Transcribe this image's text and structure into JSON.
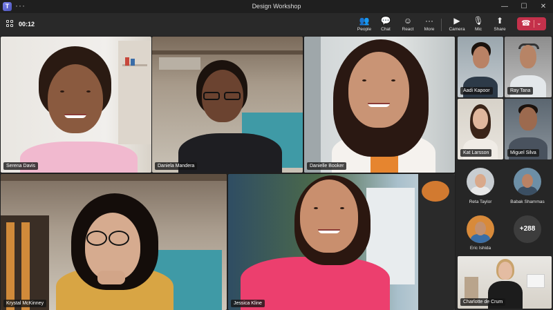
{
  "window": {
    "title": "Design Workshop",
    "app_logo": "T",
    "more_dots": "···",
    "minimize": "—",
    "maximize": "☐",
    "close": "✕"
  },
  "toolbar": {
    "timer": "00:12",
    "people": "People",
    "chat": "Chat",
    "react": "React",
    "more": "More",
    "camera": "Camera",
    "mic": "Mic",
    "share": "Share",
    "icons": {
      "people": "👥",
      "chat": "💬",
      "react": "☺",
      "more": "···",
      "camera": "▶",
      "mic": "🎙",
      "share": "⬆",
      "hangup": "☎",
      "chevron": "⌄"
    },
    "hangup_color": "#c4314b"
  },
  "participants": {
    "serena": "Serena Davis",
    "daniela": "Daniela Mandera",
    "danielle": "Danielle Booker",
    "krystal": "Krystal McKinney",
    "jessica": "Jessica Kline"
  },
  "panel": {
    "aadi": "Aadi Kapoor",
    "ray": "Ray Tana",
    "kat": "Kat Larsson",
    "miguel": "Miguel Silva",
    "reta": "Reta Taylor",
    "babak": "Babak Shammas",
    "eric": "Eric Ishida",
    "more_count": "+288",
    "charlotte": "Charlotte de Crum"
  }
}
